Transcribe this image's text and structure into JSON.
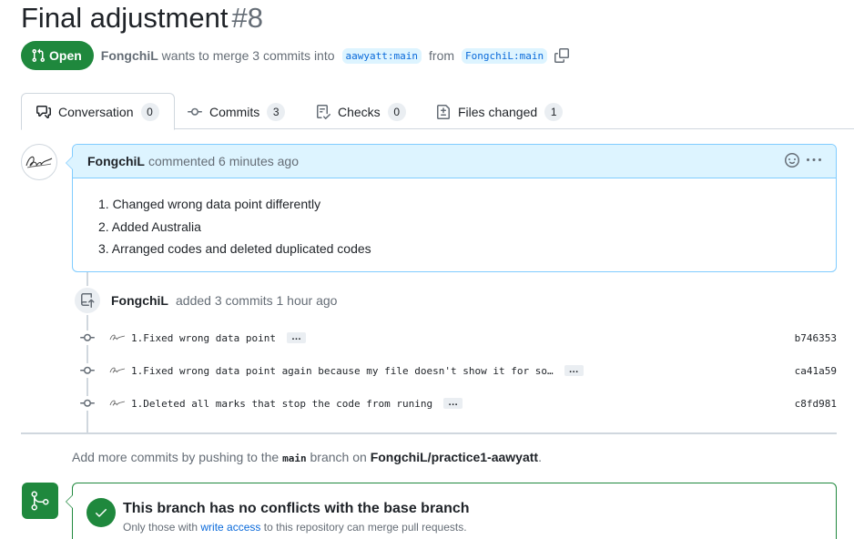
{
  "pr": {
    "title": "Final adjustment",
    "number": "#8",
    "state": "Open",
    "author": "FongchiL",
    "summary_mid": "wants to merge 3 commits into",
    "base_branch": "aawyatt:main",
    "from_word": "from",
    "head_branch": "FongchiL:main"
  },
  "tabs": [
    {
      "label": "Conversation",
      "count": "0",
      "icon": "comment-discussion-icon"
    },
    {
      "label": "Commits",
      "count": "3",
      "icon": "git-commit-icon"
    },
    {
      "label": "Checks",
      "count": "0",
      "icon": "checklist-icon"
    },
    {
      "label": "Files changed",
      "count": "1",
      "icon": "file-diff-icon"
    }
  ],
  "comment": {
    "author": "FongchiL",
    "meta": "commented 6 minutes ago",
    "items": [
      "1. Changed wrong data point differently",
      "2. Added Australia",
      "3. Arranged codes and deleted duplicated codes"
    ]
  },
  "push_event": {
    "author": "FongchiL",
    "text": "added 3 commits 1 hour ago"
  },
  "commits": [
    {
      "message": "1.Fixed wrong data point",
      "more": "…",
      "sha": "b746353"
    },
    {
      "message": "1.Fixed wrong data point again because my file doesn't show it for so…",
      "more": "…",
      "sha": "ca41a59"
    },
    {
      "message": "1.Deleted all marks that stop the code from runing",
      "more": "…",
      "sha": "c8fd981"
    }
  ],
  "hint": {
    "prefix": "Add more commits by pushing to the",
    "branch": "main",
    "mid": "branch on",
    "repo": "FongchiL/practice1-aawyatt",
    "suffix": "."
  },
  "merge": {
    "title": "This branch has no conflicts with the base branch",
    "sub_prefix": "Only those with",
    "sub_link": "write access",
    "sub_suffix": "to this repository can merge pull requests."
  },
  "colors": {
    "open_green": "#1f883d",
    "link_blue": "#0969da",
    "comment_header_bg": "#ddf4ff",
    "comment_border": "#80ccff"
  }
}
